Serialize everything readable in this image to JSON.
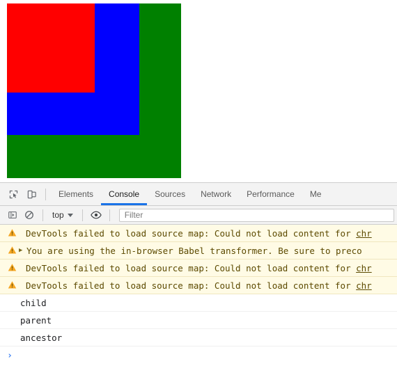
{
  "page": {
    "boxes": [
      {
        "name": "ancestor",
        "color": "#008000"
      },
      {
        "name": "parent",
        "color": "#0000ff"
      },
      {
        "name": "child",
        "color": "#ff0000"
      }
    ]
  },
  "devtools": {
    "inspect_icon": "inspect-element-icon",
    "device_icon": "device-toolbar-icon",
    "tabs": [
      {
        "label": "Elements",
        "active": false
      },
      {
        "label": "Console",
        "active": true
      },
      {
        "label": "Sources",
        "active": false
      },
      {
        "label": "Network",
        "active": false
      },
      {
        "label": "Performance",
        "active": false
      },
      {
        "label": "Me",
        "active": false
      }
    ],
    "active_tab_accent": "#1a73e8",
    "toolbar": {
      "sidebar_icon": "console-sidebar-icon",
      "clear_icon": "clear-console-icon",
      "context": "top",
      "eye_icon": "live-expression-icon",
      "filter_placeholder": "Filter",
      "filter_value": ""
    },
    "messages": [
      {
        "level": "warning",
        "expandable": false,
        "text": "DevTools failed to load source map: Could not load content for ",
        "link": "chr"
      },
      {
        "level": "warning",
        "expandable": true,
        "text": "You are using the in-browser Babel transformer. Be sure to preco",
        "link": ""
      },
      {
        "level": "warning",
        "expandable": false,
        "text": "DevTools failed to load source map: Could not load content for ",
        "link": "chr"
      },
      {
        "level": "warning",
        "expandable": false,
        "text": "DevTools failed to load source map: Could not load content for ",
        "link": "chr"
      },
      {
        "level": "log",
        "expandable": false,
        "text": "child",
        "link": ""
      },
      {
        "level": "log",
        "expandable": false,
        "text": "parent",
        "link": ""
      },
      {
        "level": "log",
        "expandable": false,
        "text": "ancestor",
        "link": ""
      }
    ],
    "prompt": {
      "chevron": "›",
      "value": ""
    }
  },
  "colors": {
    "warning_bg": "#fffbe5",
    "warning_text": "#5c4a00",
    "warning_icon": "#f5a623",
    "prompt_blue": "#4285f4",
    "tab_accent": "#1a73e8"
  }
}
